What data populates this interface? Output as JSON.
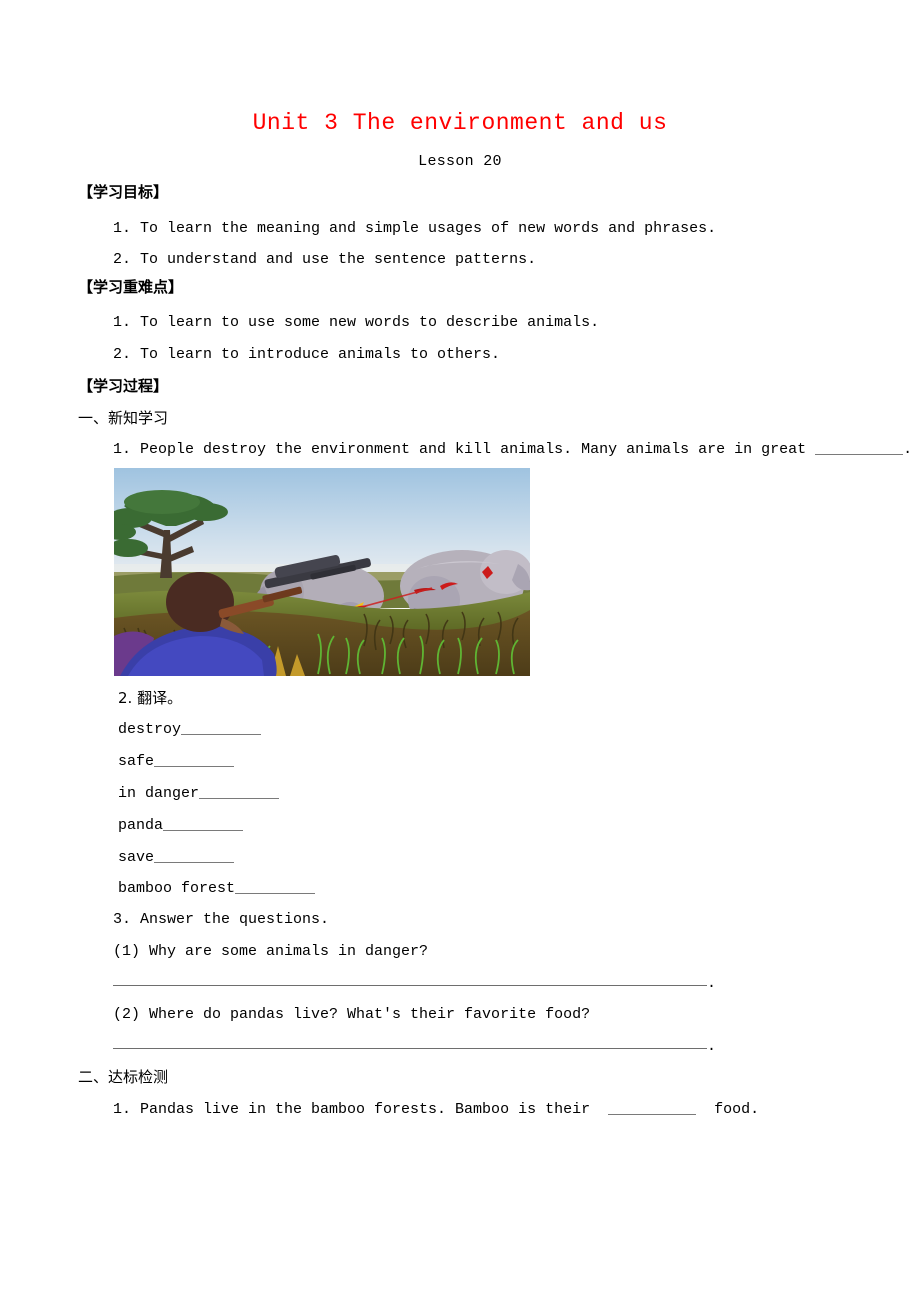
{
  "document": {
    "title": "Unit 3 The environment and us",
    "title_color": "#ff0000",
    "subtitle": "Lesson 20"
  },
  "sections": {
    "objectives": {
      "heading": "【学习目标】",
      "items": [
        "1. To learn the meaning and simple usages of new words and phrases.",
        "2. To understand and use the sentence patterns."
      ]
    },
    "key_points": {
      "heading": "【学习重难点】",
      "items": [
        "1. To learn to use some new words to describe animals.",
        "2. To learn to introduce animals to others."
      ]
    },
    "process": {
      "heading": "【学习过程】",
      "part_one": {
        "heading": "一、新知学习",
        "item1_prefix": "1. People destroy the environment and kill animals. Many animals are in great",
        "item1_suffix": ".",
        "item2_heading": "2. 翻译。",
        "vocabulary": [
          "destroy",
          "safe",
          "in danger",
          "panda",
          "save",
          "bamboo forest"
        ],
        "item3_heading": "3. Answer the questions.",
        "questions": [
          "(1) Why are some animals in danger?",
          "(2) Where do pandas live? What's their favorite food?"
        ],
        "answer_end_mark": "."
      },
      "part_two": {
        "heading": "二、达标检测",
        "item1_prefix": "1. Pandas live in the bamboo forests. Bamboo is their",
        "item1_suffix": "food."
      }
    }
  },
  "illustration": {
    "name": "hunter-shooting-elephants-savanna",
    "colors": {
      "sky_top": "#9fc3e0",
      "sky_bottom": "#f2f2f4",
      "tree_foliage": "#3a6b33",
      "tree_trunk": "#4a3b2f",
      "elephant_body": "#b3aeb8",
      "elephant_shadow": "#8d8896",
      "grass_green": "#4f9b2e",
      "grass_dark": "#5c4a1f",
      "grass_olive": "#6e7b2c",
      "hunter_shirt": "#3a3fa8",
      "hunter_hair": "#4a2b22",
      "rifle_stock": "#8a4a28",
      "rifle_barrel": "#3a3a42",
      "blood": "#cc1b1b",
      "muzzle_flash": "#f2c21c",
      "purple_patch": "#6b3a8c"
    }
  }
}
